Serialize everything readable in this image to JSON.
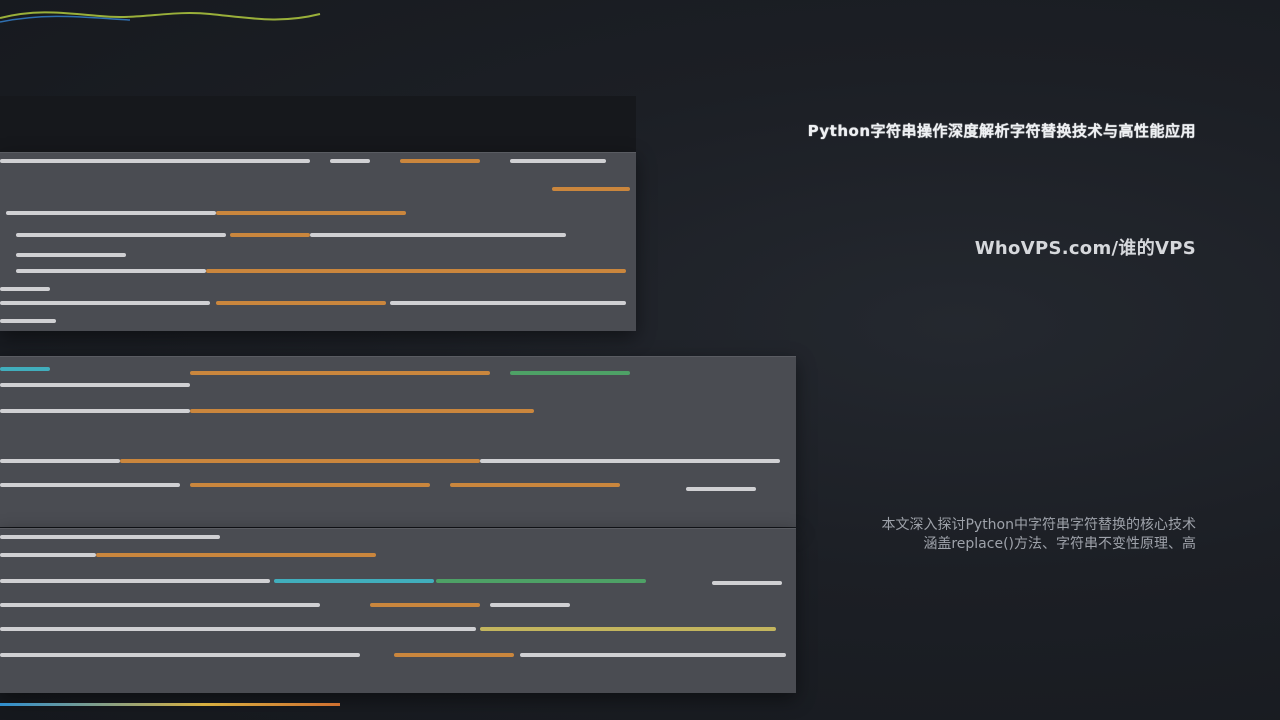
{
  "title": "Python字符串操作深度解析字符替换技术与高性能应用",
  "brand": "WhoVPS.com/谁的VPS",
  "description": {
    "line1": "本文深入探讨Python中字符串字符替换的核心技术",
    "line2": "涵盖replace()方法、字符串不变性原理、高"
  },
  "colors": {
    "background": "#1c1f25",
    "panel": "#4a4c52",
    "title_text": "#eef0f3",
    "brand_text": "#d6d8dc",
    "desc_text": "#9ea2aa"
  }
}
